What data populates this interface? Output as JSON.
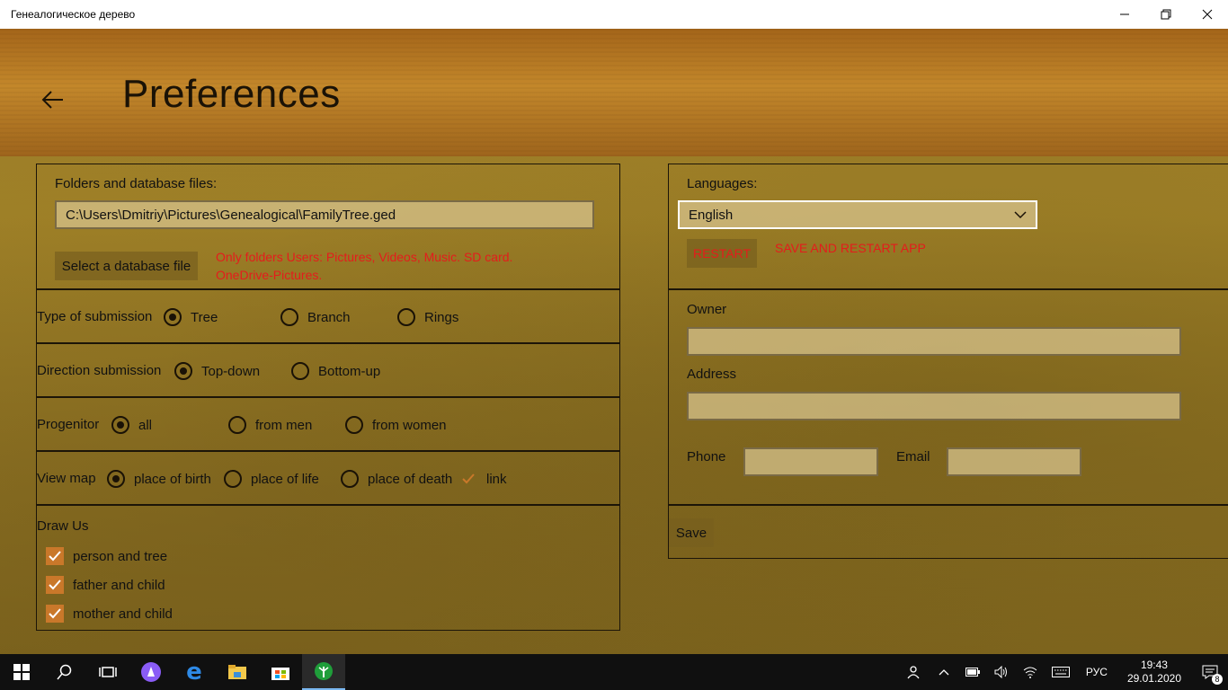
{
  "window": {
    "title": "Генеалогическое дерево",
    "controls": [
      "minimize-icon",
      "restore-icon",
      "close-icon"
    ]
  },
  "header": {
    "title": "Preferences",
    "back_icon": "arrow-left-icon"
  },
  "folders": {
    "label": "Folders and database files:",
    "path_value": "C:\\Users\\Dmitriy\\Pictures\\Genealogical\\FamilyTree.ged",
    "select_button": "Select a database file",
    "note_line1": "Only folders Users: Pictures, Videos, Music. SD card.",
    "note_line2": "OneDrive-Pictures."
  },
  "type_of_submission": {
    "label": "Type of submission",
    "options": [
      "Tree",
      "Branch",
      "Rings"
    ],
    "selected": "Tree"
  },
  "direction_submission": {
    "label": "Direction submission",
    "options": [
      "Top-down",
      "Bottom-up"
    ],
    "selected": "Top-down"
  },
  "progenitor": {
    "label": "Progenitor",
    "options": [
      "all",
      "from men",
      "from women"
    ],
    "selected": "all"
  },
  "view_map": {
    "label": "View map",
    "options": [
      "place of birth",
      "place of life",
      "place of death"
    ],
    "selected": "place of birth",
    "link_label": "link",
    "link_checked": true
  },
  "draw_us": {
    "label": "Draw Us",
    "items": [
      {
        "label": "person and tree",
        "checked": true
      },
      {
        "label": "father and child",
        "checked": true
      },
      {
        "label": "mother and child",
        "checked": true
      }
    ]
  },
  "languages": {
    "label": "Languages:",
    "selected": "English",
    "restart_button": "RESTART",
    "restart_note": "SAVE AND RESTART APP"
  },
  "owner": {
    "owner_label": "Owner",
    "owner_value": "",
    "address_label": "Address",
    "address_value": "",
    "phone_label": "Phone",
    "phone_value": "",
    "email_label": "Email",
    "email_value": ""
  },
  "save_button": "Save",
  "taskbar": {
    "language": "РУС",
    "time": "19:43",
    "date": "29.01.2020",
    "notification_count": "8"
  },
  "colors": {
    "accent_check": "#c9782a",
    "warning_text": "#e41c1c",
    "taskbar": "#101010"
  }
}
